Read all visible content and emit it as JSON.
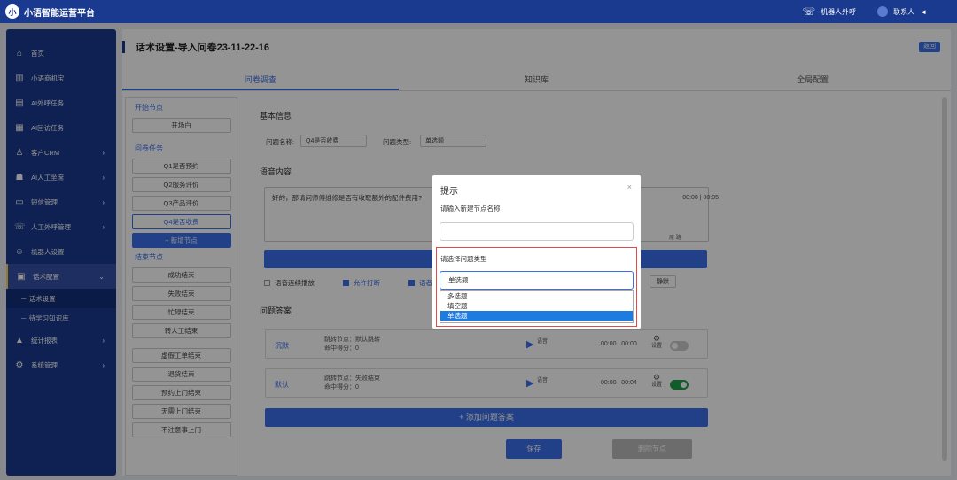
{
  "app": {
    "logo_text": "小",
    "title": "小语智能运营平台"
  },
  "topbar": {
    "robot_call": "机器人外呼",
    "contact": "联系人",
    "arrow": "◄"
  },
  "sidebar": {
    "items": [
      {
        "icon": "⌂",
        "label": "首页"
      },
      {
        "icon": "▥",
        "label": "小语商机宝"
      },
      {
        "icon": "▤",
        "label": "AI外呼任务"
      },
      {
        "icon": "▦",
        "label": "AI回访任务"
      },
      {
        "icon": "♙",
        "label": "客户CRM",
        "arrow": "›"
      },
      {
        "icon": "☗",
        "label": "AI人工坐席",
        "arrow": "›"
      },
      {
        "icon": "▭",
        "label": "短信管理",
        "arrow": "›"
      },
      {
        "icon": "☏",
        "label": "人工外呼管理",
        "arrow": "›"
      },
      {
        "icon": "☺",
        "label": "机器人设置"
      },
      {
        "icon": "▣",
        "label": "话术配置",
        "arrow": "⌄"
      }
    ],
    "subs": [
      {
        "label": "－  话术设置"
      },
      {
        "label": "－  待学习知识库"
      }
    ],
    "after": [
      {
        "icon": "▲",
        "label": "统计报表",
        "arrow": "›"
      },
      {
        "icon": "⚙",
        "label": "系统管理",
        "arrow": "›"
      }
    ]
  },
  "page": {
    "title": "话术设置-导入问卷23-11-22-16",
    "back": "返回"
  },
  "tabs": [
    "问卷调查",
    "知识库",
    "全局配置"
  ],
  "left": {
    "start_title": "开始节点",
    "start_items": [
      "开场白"
    ],
    "q_title": "问卷任务",
    "q_items": [
      "Q1是否预约",
      "Q2服务评价",
      "Q3产品评价",
      "Q4是否收费"
    ],
    "add_node": "+ 新增节点",
    "end_title": "结束节点",
    "end_items": [
      "成功结束",
      "失败结束",
      "忙碌结束",
      "转人工结束"
    ],
    "end_items2": [
      "虚假工单结束",
      "退货结束",
      "预约上门结束",
      "无需上门结束",
      "不注意事上门"
    ]
  },
  "form": {
    "basic": "基本信息",
    "qname_label": "问题名称:",
    "qname_value": "Q4是否收费",
    "qtype_label": "问题类型:",
    "qtype_value": "单选题",
    "voice": "语音内容",
    "voice_text": "好的，那请问师傅维修是否有收取额外的配件费用?",
    "voice_time": "00:00 | 00:05",
    "voice_btn": "原 路",
    "opt_continuous": "语音连续播放",
    "opt_interrupt": "允许打断",
    "opt_third": "语者",
    "silent_btn": "静默",
    "answers_title": "问题答案",
    "answers": [
      {
        "name": "沉默",
        "jump": "跳转节点：默认跳转",
        "score": "命中得分：0",
        "audio": "语音",
        "time": "00:00 | 00:00",
        "gear": "设置",
        "on": false
      },
      {
        "name": "默认",
        "jump": "跳转节点：失败结束",
        "score": "命中得分：0",
        "audio": "语音",
        "time": "00:00 | 00:04",
        "gear": "设置",
        "on": true
      }
    ],
    "add_answer": "+ 添加问题答案",
    "save": "保存",
    "delete": "删除节点"
  },
  "modal": {
    "title": "提示",
    "close": "×",
    "name_label": "请输入新建节点名称",
    "type_label": "请选择问题类型",
    "selected": "单选题",
    "options": [
      "多选题",
      "填空题",
      "单选题"
    ]
  },
  "colors": {
    "primary": "#3a6ee8",
    "nav": "#1a3a8f",
    "highlight_border": "#e04a4a",
    "option_selected": "#1e7be0"
  }
}
